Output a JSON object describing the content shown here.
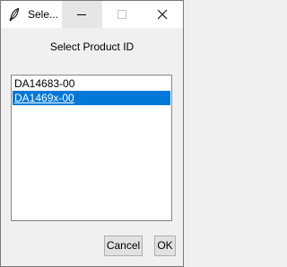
{
  "window": {
    "title": "Sele...",
    "app_icon": "feather-icon",
    "controls": {
      "minimize_icon": "minimize-icon",
      "maximize_icon": "maximize-icon",
      "close_icon": "close-icon"
    }
  },
  "dialog": {
    "prompt": "Select Product ID",
    "list": {
      "items": [
        {
          "label": "DA14683-00",
          "selected": false
        },
        {
          "label": "DA1469x-00",
          "selected": true
        }
      ]
    },
    "buttons": {
      "cancel_label": "Cancel",
      "ok_label": "OK"
    }
  },
  "colors": {
    "selection": "#0078d7",
    "window_bg": "#f0f0f0",
    "titlebar_bg": "#ffffff"
  }
}
